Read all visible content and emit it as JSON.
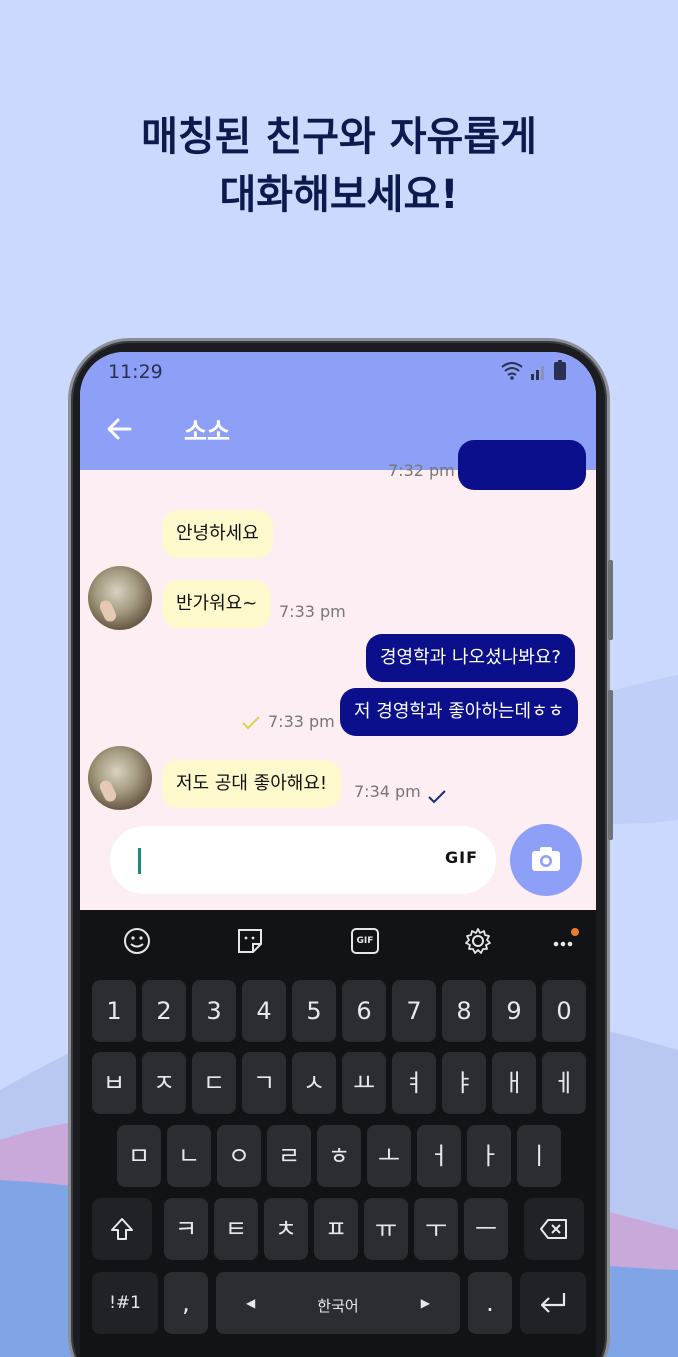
{
  "headline": {
    "line1": "매칭된 친구와 자유롭게",
    "line2": "대화해보세요!"
  },
  "status": {
    "time": "11:29"
  },
  "appbar": {
    "title": "소소",
    "back_icon": "arrow-left-icon"
  },
  "chat": {
    "top_partial": {
      "time": "7:32 pm"
    },
    "messages": [
      {
        "dir": "in",
        "text": "안녕하세요",
        "time": ""
      },
      {
        "dir": "in",
        "text": "반가워요~",
        "time": "7:33 pm"
      },
      {
        "dir": "out",
        "text": "경영학과 나오셨나봐요?",
        "time": ""
      },
      {
        "dir": "out",
        "text": "저 경영학과 좋아하는데ㅎㅎ",
        "time": "7:33 pm"
      },
      {
        "dir": "in",
        "text": "저도 공대 좋아해요!",
        "time": "7:34 pm"
      }
    ]
  },
  "composer": {
    "value": "",
    "gif_label": "GIF",
    "camera_icon": "camera-icon"
  },
  "keyboard": {
    "toolbar": [
      "emoji-icon",
      "sticker-icon",
      "gif-icon",
      "settings-gear-icon",
      "more-dots-icon"
    ],
    "gif_tool_label": "GIF",
    "row_numbers": [
      "1",
      "2",
      "3",
      "4",
      "5",
      "6",
      "7",
      "8",
      "9",
      "0"
    ],
    "row1": [
      "ㅂ",
      "ㅈ",
      "ㄷ",
      "ㄱ",
      "ㅅ",
      "ㅛ",
      "ㅕ",
      "ㅑ",
      "ㅐ",
      "ㅔ"
    ],
    "row2": [
      "ㅁ",
      "ㄴ",
      "ㅇ",
      "ㄹ",
      "ㅎ",
      "ㅗ",
      "ㅓ",
      "ㅏ",
      "ㅣ"
    ],
    "row3": [
      "ㅋ",
      "ㅌ",
      "ㅊ",
      "ㅍ",
      "ㅠ",
      "ㅜ",
      "ㅡ"
    ],
    "symbols_key": "!#1",
    "comma_key": ",",
    "space_label": "한국어",
    "period_key": "."
  },
  "colors": {
    "background": "#ccd9ff",
    "app_bar": "#8d9ff6",
    "outgoing_bubble": "#0b0f8c",
    "incoming_bubble": "#fdf9cc",
    "chat_bg": "#fdeef3"
  }
}
